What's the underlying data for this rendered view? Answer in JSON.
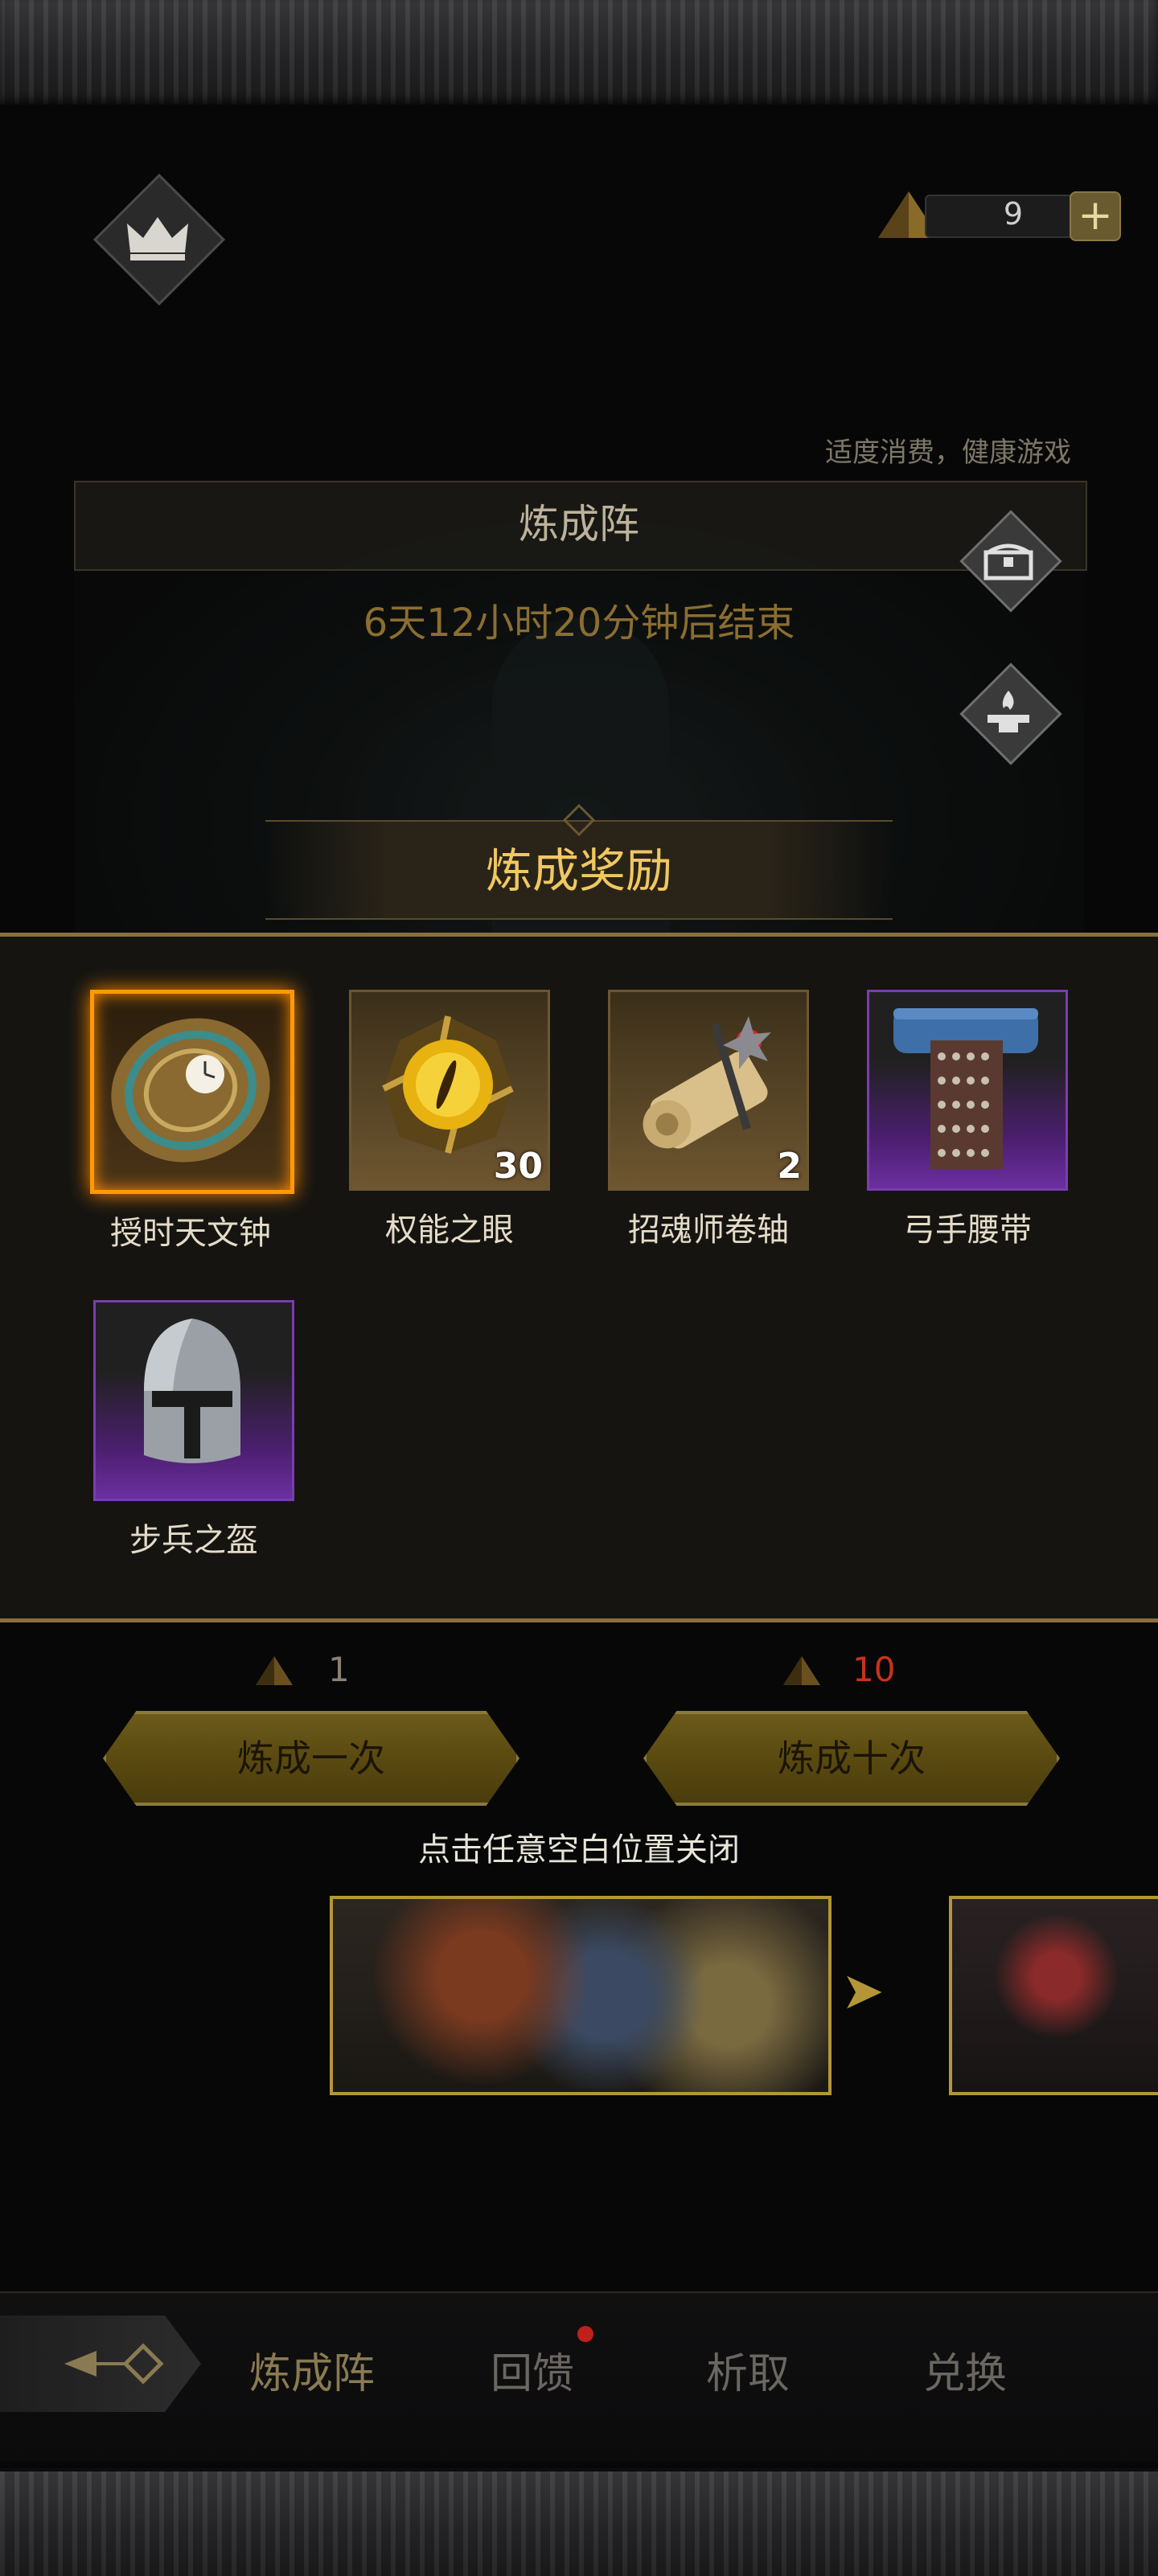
{
  "header": {
    "currency_count": "9",
    "plus_label": "+",
    "health_tip": "适度消费，健康游戏"
  },
  "panel": {
    "title": "炼成阵",
    "countdown": "6天12小时20分钟后结束"
  },
  "reward_popup": {
    "title": "炼成奖励",
    "items": [
      {
        "name": "授时天文钟",
        "count": "",
        "rarity": "legendary"
      },
      {
        "name": "权能之眼",
        "count": "30",
        "rarity": "gold"
      },
      {
        "name": "招魂师卷轴",
        "count": "2",
        "rarity": "gold"
      },
      {
        "name": "弓手腰带",
        "count": "",
        "rarity": "purple"
      },
      {
        "name": "步兵之盔",
        "count": "",
        "rarity": "purple"
      }
    ]
  },
  "actions": {
    "cost_once": "1",
    "cost_ten": "10",
    "once_label": "炼成一次",
    "ten_label": "炼成十次",
    "close_hint": "点击任意空白位置关闭",
    "next_arrow": "➤"
  },
  "nav": {
    "tabs": [
      "炼成阵",
      "回馈",
      "析取",
      "兑换"
    ],
    "active_index": 0
  },
  "colors": {
    "accent_gold": "#f0c862",
    "cost_red": "#c9321c",
    "legendary": "#ff9a00",
    "epic": "#6b2fa0"
  }
}
